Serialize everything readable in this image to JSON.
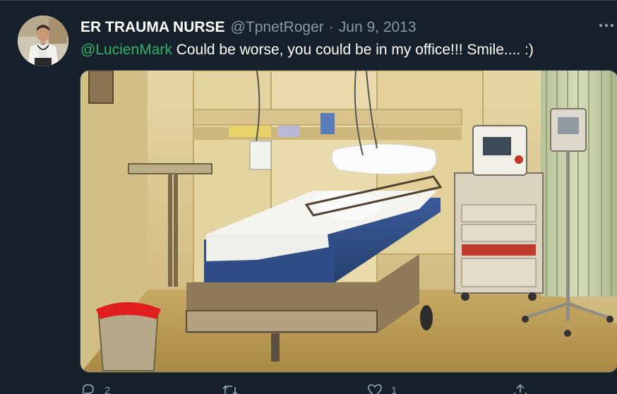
{
  "tweet": {
    "display_name": "ER TRAUMA NURSE",
    "handle": "@TpnetRoger",
    "separator": "·",
    "date": "Jun 9, 2013",
    "more_label": "•••",
    "mention": "@LucienMark",
    "text": " Could be worse, you could be in my office!!! Smile.... :)",
    "media_description_icon": "hospital-trauma-room-photo",
    "actions": {
      "reply_count": "2",
      "retweet_count": "",
      "like_count": "1",
      "share_count": ""
    }
  },
  "colors": {
    "background": "#15202b",
    "secondary_text": "#8899a6",
    "mention": "#32b268",
    "border": "#38444d"
  }
}
